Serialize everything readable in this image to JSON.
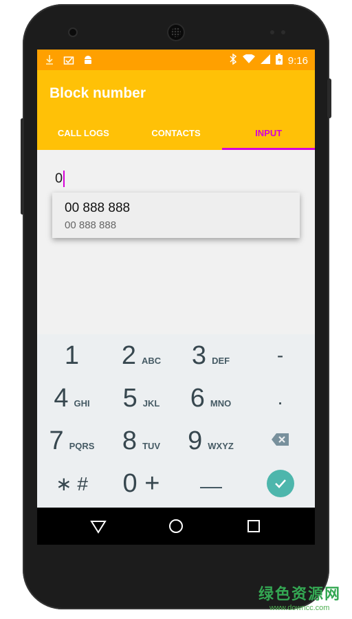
{
  "status": {
    "time": "9:16"
  },
  "toolbar": {
    "title": "Block number"
  },
  "tabs": [
    {
      "label": "CALL LOGS"
    },
    {
      "label": "CONTACTS"
    },
    {
      "label": "INPUT"
    }
  ],
  "input": {
    "value": "0"
  },
  "suggestion": {
    "primary": "00 888 888",
    "secondary": "00 888 888"
  },
  "keypad": {
    "rows": [
      [
        {
          "digit": "1",
          "letters": ""
        },
        {
          "digit": "2",
          "letters": "ABC"
        },
        {
          "digit": "3",
          "letters": "DEF"
        },
        {
          "digit": "-",
          "letters": ""
        }
      ],
      [
        {
          "digit": "4",
          "letters": "GHI"
        },
        {
          "digit": "5",
          "letters": "JKL"
        },
        {
          "digit": "6",
          "letters": "MNO"
        },
        {
          "digit": ".",
          "letters": ""
        }
      ],
      [
        {
          "digit": "7",
          "letters": "PQRS"
        },
        {
          "digit": "8",
          "letters": "TUV"
        },
        {
          "digit": "9",
          "letters": "WXYZ"
        }
      ],
      [
        {
          "digit": "∗ #",
          "letters": ""
        },
        {
          "digit": "0 +",
          "letters": ""
        }
      ]
    ]
  },
  "colors": {
    "status_bar": "#ffa000",
    "toolbar": "#ffc107",
    "accent": "#d500d8",
    "confirm": "#4db6ac"
  },
  "watermark": {
    "text": "绿色资源网",
    "url": "www.downcc.com"
  }
}
